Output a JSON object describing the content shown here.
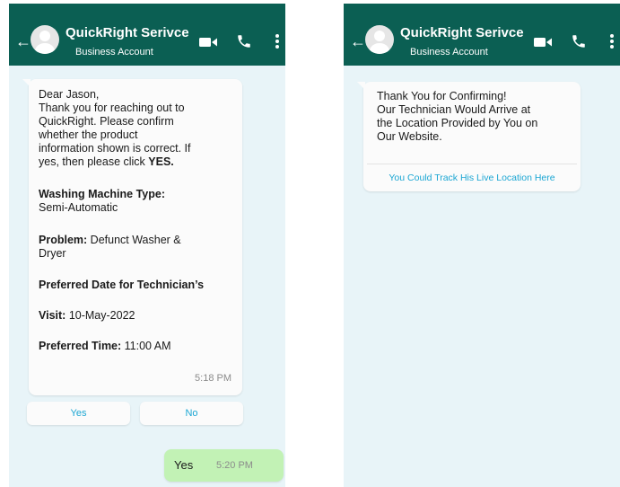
{
  "chat_header": {
    "title": "QuickRight Serivce",
    "subtitle": "Business Account",
    "back_glyph": "←",
    "icons": [
      "back-arrow-icon",
      "avatar-icon",
      "video-call-icon",
      "phone-call-icon",
      "more-vertical-icon"
    ],
    "color": "#0b5f53"
  },
  "left_chat": {
    "message": {
      "line1": "Dear Jason,",
      "line2": "Thank you for reaching out to",
      "line3": "QuickRight. Please confirm",
      "line4": "whether the product",
      "line5": "information shown is correct. If",
      "line6_a": "yes, then please click ",
      "line6_b": "YES.",
      "machine_label": "Washing Machine Type:",
      "machine_value": "Semi-Automatic",
      "problem_label": "Problem:",
      "problem_value_1": " Defunct Washer &",
      "problem_value_2": "Dryer",
      "date_label_1": "Preferred Date for Technician’s",
      "date_label_2": "Visit:",
      "date_value": " 10-May-2022",
      "time_label": "Preferred Time:",
      "time_value": " 11:00 AM",
      "timestamp": "5:18 PM"
    },
    "quick_replies": {
      "yes": "Yes",
      "no": "No"
    },
    "reply": {
      "text": "Yes",
      "timestamp": "5:20 PM",
      "color": "#c2f2b5"
    }
  },
  "right_chat": {
    "message": {
      "line1": "Thank You for Confirming!",
      "line2": "Our Technician Would Arrive at",
      "line3": "the Location Provided by You on",
      "line4": "Our Website."
    },
    "link": "You Could Track His Live Location Here",
    "link_color": "#1ba6d3"
  },
  "background_color": "#e8f4f8"
}
